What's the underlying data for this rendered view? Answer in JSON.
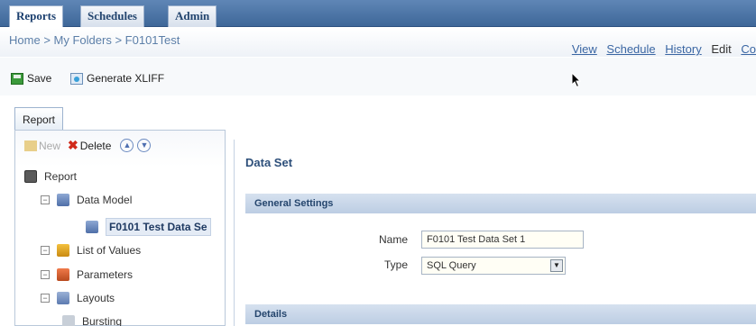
{
  "top_tabs": [
    {
      "label": "Reports",
      "active": true
    },
    {
      "label": "Schedules",
      "active": false
    },
    {
      "label": "Admin",
      "active": false
    }
  ],
  "breadcrumb": {
    "home": "Home",
    "sep": ">",
    "folder": "My Folders",
    "current": "F0101Test"
  },
  "actions": {
    "view": "View",
    "schedule": "Schedule",
    "history": "History",
    "edit": "Edit",
    "partial": "Co"
  },
  "toolbar": {
    "save_label": "Save",
    "xliff_label": "Generate XLIFF"
  },
  "report_tab": "Report",
  "tree_toolbar": {
    "new_label": "New",
    "delete_label": "Delete"
  },
  "tree": {
    "report": "Report",
    "data_model": "Data Model",
    "data_set": "F0101 Test Data Se",
    "list_of_values": "List of Values",
    "parameters": "Parameters",
    "layouts": "Layouts",
    "bursting": "Bursting"
  },
  "form": {
    "title": "Data Set",
    "general_settings": "General Settings",
    "name_label": "Name",
    "name_value": "F0101 Test Data Set 1",
    "type_label": "Type",
    "type_value": "SQL Query",
    "details": "Details"
  }
}
